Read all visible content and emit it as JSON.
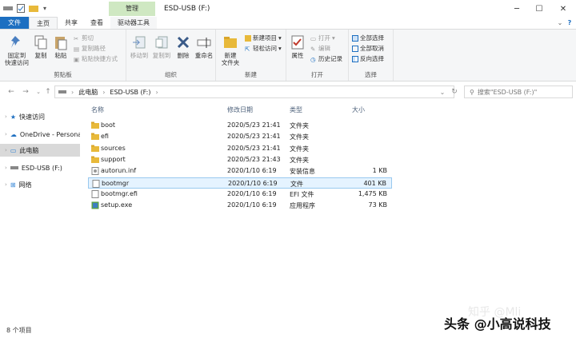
{
  "window": {
    "title": "ESD-USB (F:)",
    "context_tab": "管理",
    "context_subtab": "驱动器工具"
  },
  "tabs": [
    "文件",
    "主页",
    "共享",
    "查看"
  ],
  "ribbon": {
    "clipboard": {
      "label": "剪贴板",
      "pin": "固定到\n快速访问",
      "copy": "复制",
      "paste": "粘贴",
      "cut": "剪切",
      "copy_path": "复制路径",
      "paste_shortcut": "粘贴快捷方式"
    },
    "organize": {
      "label": "组织",
      "move_to": "移动到",
      "copy_to": "复制到",
      "delete": "删除",
      "rename": "重命名"
    },
    "new": {
      "label": "新建",
      "new_folder": "新建\n文件夹",
      "new_item": "新建项目",
      "easy_access": "轻松访问"
    },
    "open": {
      "label": "打开",
      "properties": "属性",
      "open": "打开",
      "edit": "编辑",
      "history": "历史记录"
    },
    "select": {
      "label": "选择",
      "select_all": "全部选择",
      "select_none": "全部取消",
      "invert": "反向选择"
    }
  },
  "address": {
    "crumbs": [
      "此电脑",
      "ESD-USB (F:)"
    ],
    "search_placeholder": "搜索\"ESD-USB (F:)\""
  },
  "nav_pane": {
    "items": [
      "快速访问",
      "OneDrive - Persona",
      "此电脑",
      "ESD-USB (F:)",
      "网络"
    ]
  },
  "columns": [
    "名称",
    "修改日期",
    "类型",
    "大小"
  ],
  "files": [
    {
      "name": "boot",
      "date": "2020/5/23 21:41",
      "type": "文件夹",
      "size": "",
      "icon": "folder"
    },
    {
      "name": "efi",
      "date": "2020/5/23 21:41",
      "type": "文件夹",
      "size": "",
      "icon": "folder"
    },
    {
      "name": "sources",
      "date": "2020/5/23 21:41",
      "type": "文件夹",
      "size": "",
      "icon": "folder"
    },
    {
      "name": "support",
      "date": "2020/5/23 21:43",
      "type": "文件夹",
      "size": "",
      "icon": "folder"
    },
    {
      "name": "autorun.inf",
      "date": "2020/1/10 6:19",
      "type": "安装信息",
      "size": "1 KB",
      "icon": "inf-file"
    },
    {
      "name": "bootmgr",
      "date": "2020/1/10 6:19",
      "type": "文件",
      "size": "401 KB",
      "icon": "file"
    },
    {
      "name": "bootmgr.efi",
      "date": "2020/1/10 6:19",
      "type": "EFI 文件",
      "size": "1,475 KB",
      "icon": "file"
    },
    {
      "name": "setup.exe",
      "date": "2020/1/10 6:19",
      "type": "应用程序",
      "size": "73 KB",
      "icon": "exe"
    }
  ],
  "status": {
    "count": "8 个项目"
  },
  "watermark": {
    "text": "头条 @小高说科技",
    "faint": "知乎 @Mli"
  },
  "colors": {
    "accent": "#1d6fc1",
    "folder": "#e8b93a",
    "context": "#cfe8c2",
    "selection": "#e5f3ff"
  }
}
